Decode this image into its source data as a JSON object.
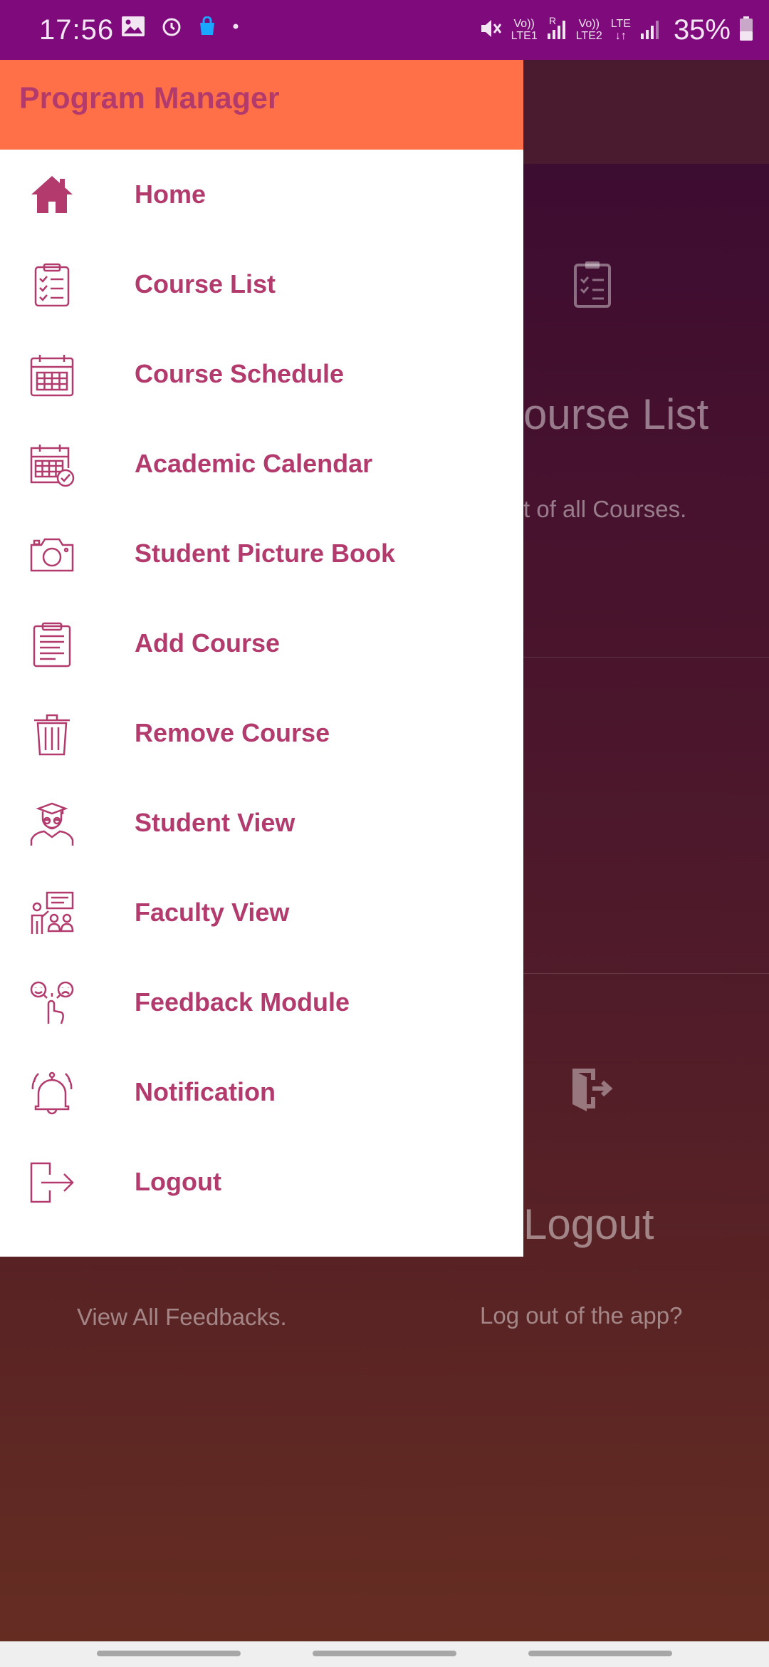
{
  "status_bar": {
    "time": "17:56",
    "battery_text": "35%",
    "sim1_top": "Vo))",
    "sim1_bottom": "LTE1",
    "roaming": "R",
    "sim2_top": "Vo))",
    "sim2_bottom": "LTE2",
    "network_type": "LTE"
  },
  "drawer": {
    "title": "Program Manager",
    "items": [
      {
        "label": "Home",
        "icon": "home-icon"
      },
      {
        "label": "Course List",
        "icon": "clipboard-checklist-icon"
      },
      {
        "label": "Course Schedule",
        "icon": "calendar-icon"
      },
      {
        "label": "Academic Calendar",
        "icon": "calendar-check-icon"
      },
      {
        "label": "Student Picture Book",
        "icon": "camera-icon"
      },
      {
        "label": "Add Course",
        "icon": "clipboard-document-icon"
      },
      {
        "label": "Remove Course",
        "icon": "trash-icon"
      },
      {
        "label": "Student View",
        "icon": "graduate-icon"
      },
      {
        "label": "Faculty View",
        "icon": "classroom-icon"
      },
      {
        "label": "Feedback Module",
        "icon": "feedback-faces-icon"
      },
      {
        "label": "Notification",
        "icon": "bell-icon"
      },
      {
        "label": "Logout",
        "icon": "logout-icon"
      }
    ]
  },
  "background": {
    "card_course_list_title": "ourse List",
    "card_course_list_desc": "t of all Courses.",
    "card_logout_title": "Logout",
    "card_logout_desc": "Log out of the app?",
    "card_feedback_desc": "View All Feedbacks."
  },
  "colors": {
    "status_bar": "#7e0a7b",
    "drawer_header": "#ff7048",
    "accent_text": "#b33a6c"
  }
}
